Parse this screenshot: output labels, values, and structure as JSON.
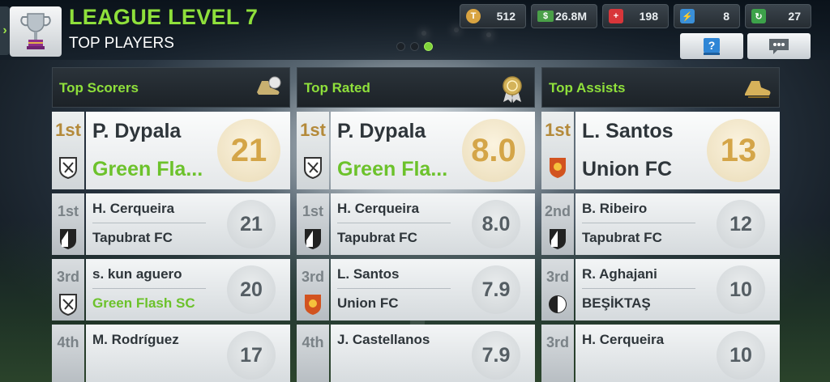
{
  "header": {
    "title": "LEAGUE LEVEL 7",
    "subtitle": "TOP PLAYERS",
    "resources": [
      {
        "icon": "token-icon",
        "value": "512"
      },
      {
        "icon": "money-icon",
        "value": "26.8M"
      },
      {
        "icon": "medical-icon",
        "value": "198"
      },
      {
        "icon": "energy-icon",
        "value": "8"
      },
      {
        "icon": "training-icon",
        "value": "27"
      }
    ],
    "page_dots": {
      "count": 3,
      "active": 3
    }
  },
  "columns": [
    {
      "title": "Top Scorers",
      "icon": "golden-boot-icon",
      "rows": [
        {
          "rank": "1st",
          "player": "P. Dypala",
          "club": "Green Fla...",
          "club_highlight": true,
          "crest": "green-flash-crest",
          "value": "21"
        },
        {
          "rank": "1st",
          "player": "H. Cerqueira",
          "club": "Tapubrat FC",
          "club_highlight": false,
          "crest": "tapubrat-crest",
          "value": "21"
        },
        {
          "rank": "3rd",
          "player": "s. kun aguero",
          "club": "Green Flash SC",
          "club_highlight": true,
          "crest": "green-flash-crest",
          "value": "20"
        },
        {
          "rank": "4th",
          "player": "M. Rodríguez",
          "club": "",
          "club_highlight": false,
          "crest": "",
          "value": "17"
        }
      ]
    },
    {
      "title": "Top Rated",
      "icon": "medal-icon",
      "rows": [
        {
          "rank": "1st",
          "player": "P. Dypala",
          "club": "Green Fla...",
          "club_highlight": true,
          "crest": "green-flash-crest",
          "value": "8.0"
        },
        {
          "rank": "1st",
          "player": "H. Cerqueira",
          "club": "Tapubrat FC",
          "club_highlight": false,
          "crest": "tapubrat-crest",
          "value": "8.0"
        },
        {
          "rank": "3rd",
          "player": "L. Santos",
          "club": "Union FC",
          "club_highlight": false,
          "crest": "union-crest",
          "value": "7.9"
        },
        {
          "rank": "4th",
          "player": "J. Castellanos",
          "club": "",
          "club_highlight": false,
          "crest": "",
          "value": "7.9"
        }
      ]
    },
    {
      "title": "Top Assists",
      "icon": "golden-boot-icon",
      "rows": [
        {
          "rank": "1st",
          "player": "L. Santos",
          "club": "Union FC",
          "club_highlight": false,
          "crest": "union-crest",
          "value": "13"
        },
        {
          "rank": "2nd",
          "player": "B. Ribeiro",
          "club": "Tapubrat FC",
          "club_highlight": false,
          "crest": "tapubrat-crest",
          "value": "12"
        },
        {
          "rank": "3rd",
          "player": "R. Aghajani",
          "club": "BEŞİKTAŞ",
          "club_highlight": false,
          "crest": "besiktas-crest",
          "value": "10"
        },
        {
          "rank": "3rd",
          "player": "H. Cerqueira",
          "club": "",
          "club_highlight": false,
          "crest": "",
          "value": "10"
        }
      ]
    }
  ],
  "colors": {
    "accent_green": "#8fe03b",
    "gold": "#d4a548"
  }
}
